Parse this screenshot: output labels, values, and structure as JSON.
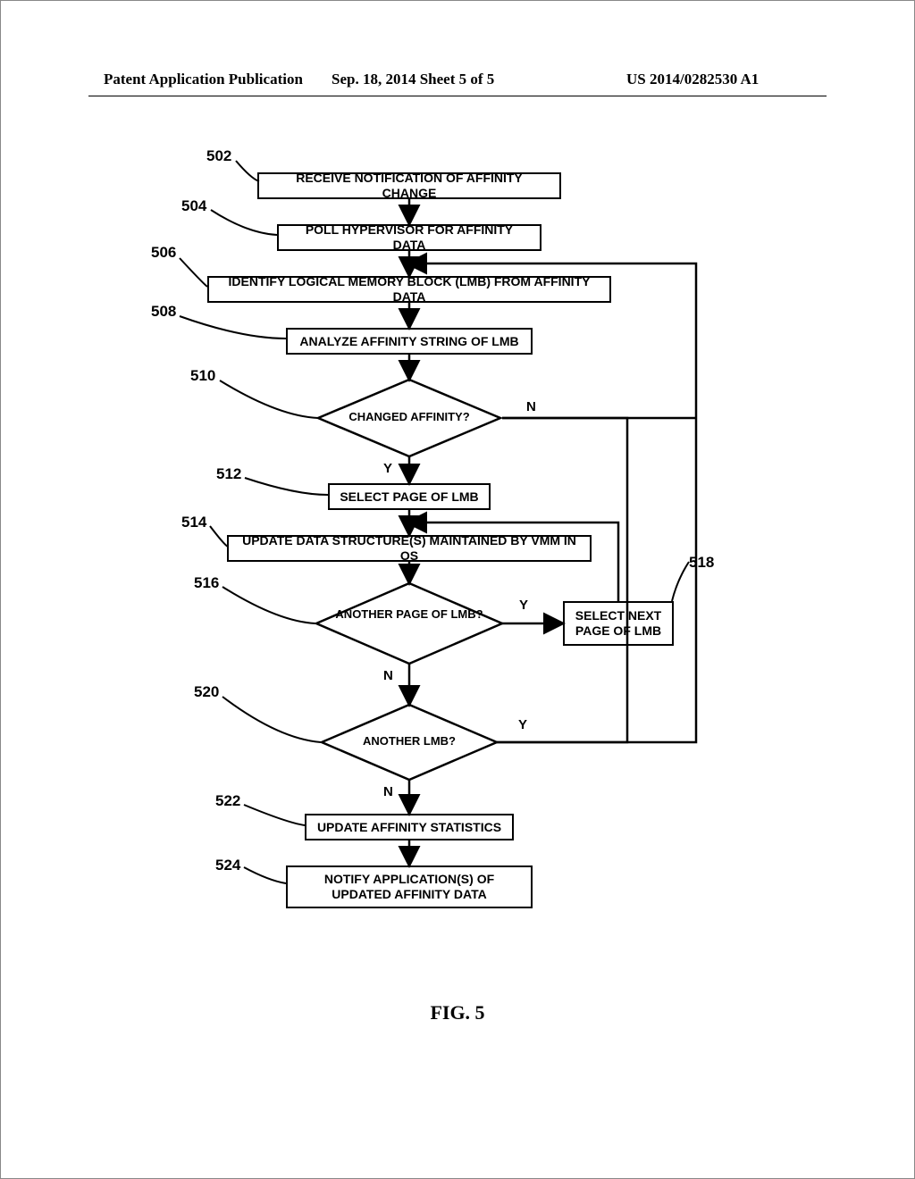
{
  "header": {
    "left": "Patent Application Publication",
    "mid": "Sep. 18, 2014  Sheet 5 of 5",
    "right": "US 2014/0282530 A1"
  },
  "refs": {
    "r502": "502",
    "r504": "504",
    "r506": "506",
    "r508": "508",
    "r510": "510",
    "r512": "512",
    "r514": "514",
    "r516": "516",
    "r518": "518",
    "r520": "520",
    "r522": "522",
    "r524": "524"
  },
  "steps": {
    "s502": "RECEIVE NOTIFICATION OF AFFINITY CHANGE",
    "s504": "POLL HYPERVISOR FOR AFFINITY DATA",
    "s506": "IDENTIFY LOGICAL MEMORY BLOCK (LMB) FROM AFFINITY DATA",
    "s508": "ANALYZE AFFINITY STRING OF LMB",
    "s512": "SELECT PAGE OF LMB",
    "s514": "UPDATE DATA STRUCTURE(S) MAINTAINED BY VMM IN OS",
    "s518": "SELECT NEXT PAGE OF LMB",
    "s522": "UPDATE AFFINITY STATISTICS",
    "s524": "NOTIFY APPLICATION(S) OF UPDATED AFFINITY DATA"
  },
  "decisions": {
    "d510": "CHANGED AFFINITY?",
    "d516": "ANOTHER PAGE OF LMB?",
    "d520": "ANOTHER LMB?"
  },
  "labels": {
    "yes": "Y",
    "no": "N"
  },
  "figure": "FIG. 5"
}
